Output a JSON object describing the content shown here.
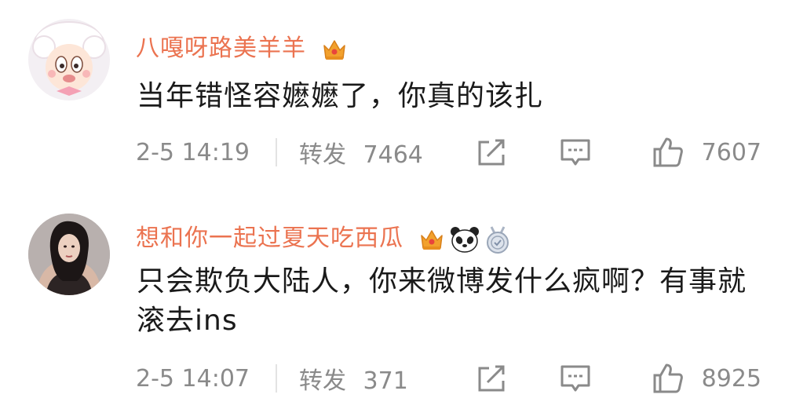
{
  "comments": [
    {
      "username": "八嘎呀路美羊羊",
      "text": "当年错怪容嬷嬷了，你真的该扎",
      "time": "2-5 14:19",
      "repost_label": "转发",
      "repost_count": "7464",
      "like_count": "7607",
      "badges": [
        "crown-icon"
      ]
    },
    {
      "username": "想和你一起过夏天吃西瓜",
      "text": "只会欺负大陆人，你来微博发什么疯啊？有事就滚去ins",
      "time": "2-5 14:07",
      "repost_label": "转发",
      "repost_count": "371",
      "like_count": "8925",
      "badges": [
        "crown-icon",
        "panda-icon",
        "medal-icon"
      ]
    }
  ],
  "colors": {
    "username": "#eb7350",
    "text": "#1a1a1a",
    "meta": "#8a8a8a",
    "crown": "#f2a12d"
  }
}
